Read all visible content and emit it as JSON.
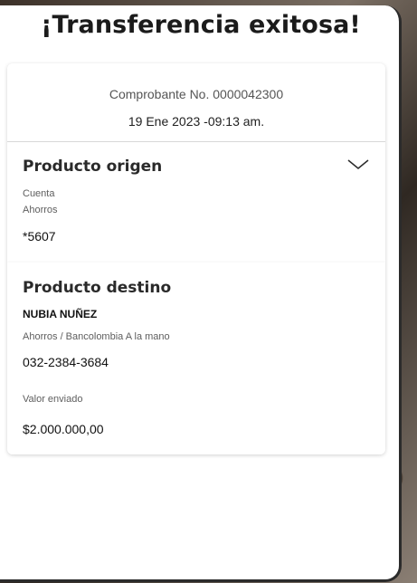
{
  "title": "¡Transferencia exitosa!",
  "receipt": {
    "number": "Comprobante No. 0000042300",
    "date": "19 Ene 2023 -09:13 am."
  },
  "origin": {
    "title": "Producto origen",
    "account_label": "Cuenta",
    "account_type": "Ahorros",
    "account_number": "*5607"
  },
  "destination": {
    "title": "Producto destino",
    "name": "NUBIA NUÑEZ",
    "details": "Ahorros / Bancolombia A la mano",
    "account_number": "032-2384-3684",
    "amount_label": "Valor enviado",
    "amount": "$2.000.000,00"
  },
  "icons": {
    "expand": "chevron-down-icon"
  }
}
